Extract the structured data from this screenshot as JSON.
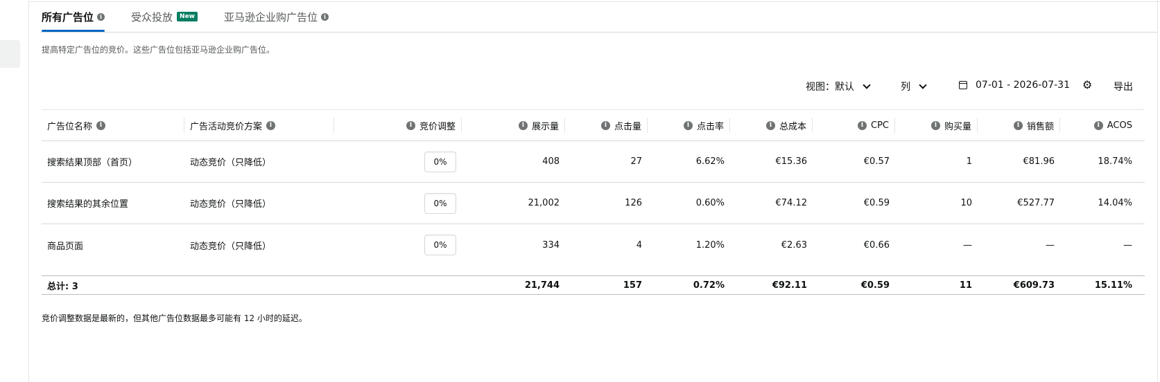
{
  "tabs": [
    {
      "label": "所有广告位",
      "active": true,
      "has_info": true
    },
    {
      "label": "受众投放",
      "badge": "New"
    },
    {
      "label": "亚马逊企业购广告位",
      "has_info": true
    }
  ],
  "description": "提高特定广告位的竞价。这些广告位包括亚马逊企业购广告位。",
  "toolbar": {
    "view_label": "视图：默认",
    "columns_label": "列",
    "date_range": "07-01 - 2026-07-31",
    "export_label": "导出"
  },
  "table": {
    "headers": [
      "广告位名称",
      "广告活动竞价方案",
      "竞价调整",
      "展示量",
      "点击量",
      "点击率",
      "总成本",
      "CPC",
      "购买量",
      "销售额",
      "ACOS"
    ],
    "rows": [
      {
        "name": "搜索结果顶部（首页）",
        "strategy": "动态竞价（只降低）",
        "bid": "0%",
        "impressions": "408",
        "clicks": "27",
        "ctr": "6.62%",
        "cost": "€15.36",
        "cpc": "€0.57",
        "purchases": "1",
        "sales": "€81.96",
        "acos": "18.74%"
      },
      {
        "name": "搜索结果的其余位置",
        "strategy": "动态竞价（只降低）",
        "bid": "0%",
        "impressions": "21,002",
        "clicks": "126",
        "ctr": "0.60%",
        "cost": "€74.12",
        "cpc": "€0.59",
        "purchases": "10",
        "sales": "€527.77",
        "acos": "14.04%"
      },
      {
        "name": "商品页面",
        "strategy": "动态竞价（只降低）",
        "bid": "0%",
        "impressions": "334",
        "clicks": "4",
        "ctr": "1.20%",
        "cost": "€2.63",
        "cpc": "€0.66",
        "purchases": "—",
        "sales": "—",
        "acos": "—"
      }
    ],
    "total": {
      "label": "总计: 3",
      "impressions": "21,744",
      "clicks": "157",
      "ctr": "0.72%",
      "cost": "€92.11",
      "cpc": "€0.59",
      "purchases": "11",
      "sales": "€609.73",
      "acos": "15.11%"
    }
  },
  "footnote": "竞价调整数据是最新的，但其他广告位数据最多可能有 12 小时的延迟。",
  "colors": {
    "accent": "#0066c0",
    "badge": "#067d62"
  },
  "icons": {
    "info": "info-icon",
    "settings": "gear-icon",
    "calendar": "calendar-icon",
    "dropdown": "chevron-down-icon"
  }
}
